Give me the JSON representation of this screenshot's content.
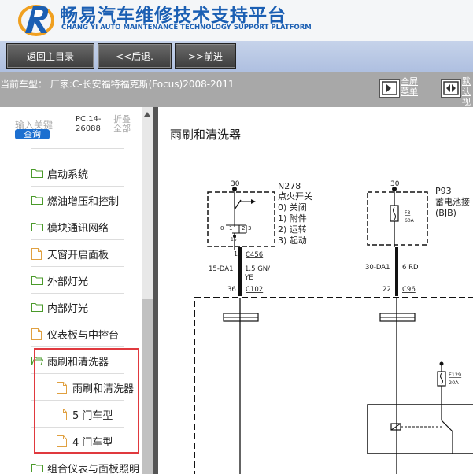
{
  "header": {
    "title": "畅易汽车维修技术支持平台",
    "subtitle": "CHANG YI AUTO MAINTENANCE TECHNOLOGY SUPPORT PLATFORM",
    "brand_color": "#1b5fb3"
  },
  "nav": {
    "back_main": "返回主目录",
    "back": "<<后退.",
    "forward": ">>前进"
  },
  "info": {
    "current_model": "当前车型： 厂家:C-长安福特福克斯(Focus)2008-2011",
    "fullscreen": "全屏菜单",
    "other": "默认视"
  },
  "sidebar": {
    "search_label": "输入关键",
    "search_button": "查询",
    "pc_code": "PC.14-26088",
    "fold_label": "折叠全部",
    "items": [
      {
        "label": "启动系统",
        "type": "folder"
      },
      {
        "label": "燃油增压和控制",
        "type": "folder"
      },
      {
        "label": "模块通讯网络",
        "type": "folder"
      },
      {
        "label": "天窗开启面板",
        "type": "page"
      },
      {
        "label": "外部灯光",
        "type": "folder"
      },
      {
        "label": "内部灯光",
        "type": "folder"
      },
      {
        "label": "仪表板与中控台",
        "type": "page"
      },
      {
        "label": "雨刷和清洗器",
        "type": "folder-open"
      },
      {
        "label": "雨刷和清洗器",
        "type": "page"
      },
      {
        "label": "5 门车型",
        "type": "page"
      },
      {
        "label": "4 门车型",
        "type": "page"
      },
      {
        "label": "组合仪表与面板照明",
        "type": "folder"
      }
    ],
    "highlight_color": "#e0393e"
  },
  "main": {
    "doc_title": "雨刷和清洗器",
    "diagram": {
      "n278": "N278",
      "n278_name": "点火开关",
      "n278_states": [
        "0) 关闭",
        "1) 附件",
        "2) 运转",
        "3) 起动"
      ],
      "p93": "P93",
      "p93_name": "蓄电池接",
      "p93_sub": "(BJB)",
      "switch_top_pin": "30",
      "switch_positions": [
        "0",
        "1",
        "2",
        "3"
      ],
      "switch_bottom_pin": "15",
      "pin_1": "1",
      "c456": "C456",
      "wire_15da1": "15-DA1",
      "wire_gn_ye": "1.5 GN/",
      "wire_gn_ye_2": "YE",
      "pin_36": "36",
      "c102": "C102",
      "p93_pin": "30",
      "fuse_f8": "F8",
      "fuse_f8_amp": "60A",
      "wire_30da1": "30-DA1",
      "wire_6rd": "6 RD",
      "pin_22": "22",
      "c96": "C96",
      "fuse_f129": "F129",
      "fuse_f129_amp": "20A"
    }
  }
}
